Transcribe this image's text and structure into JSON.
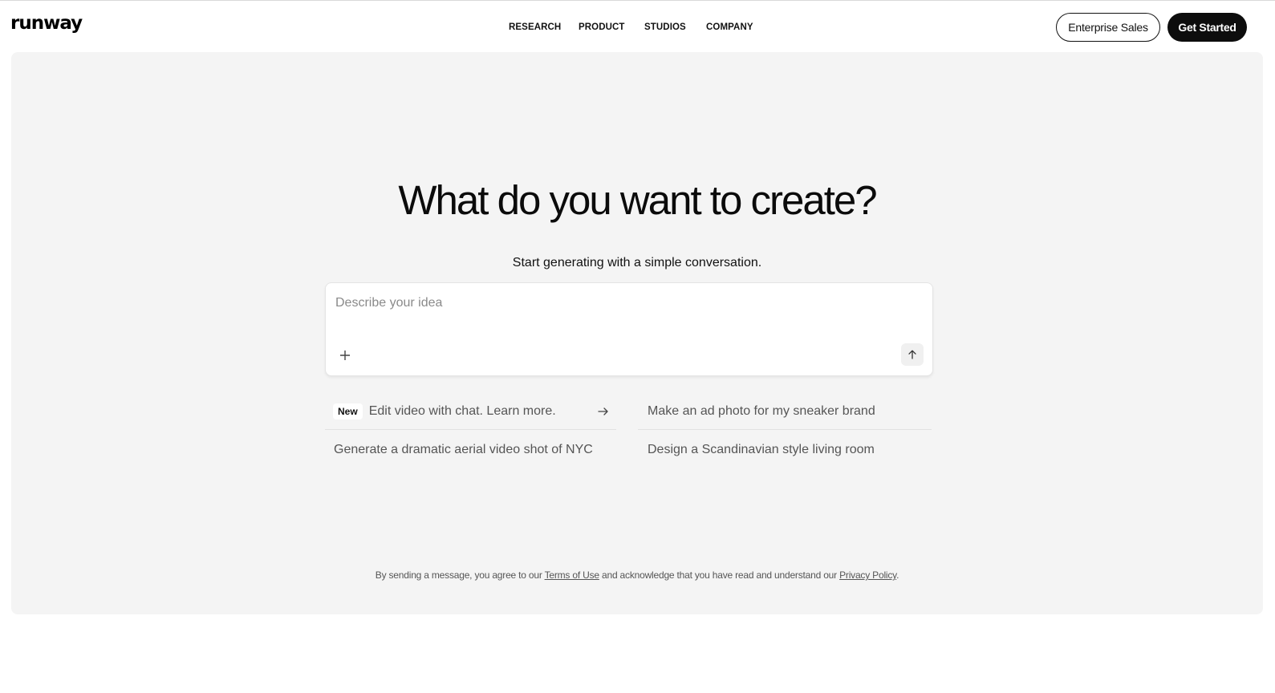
{
  "header": {
    "logo": "runway",
    "nav": [
      "RESEARCH",
      "PRODUCT",
      "STUDIOS",
      "COMPANY"
    ],
    "enterprise_label": "Enterprise Sales",
    "get_started_label": "Get Started"
  },
  "hero": {
    "title": "What do you want to create?",
    "subtitle": "Start generating with a simple conversation."
  },
  "prompt": {
    "placeholder": "Describe your idea",
    "value": "",
    "attach_icon": "plus-icon",
    "send_icon": "arrow-up-icon"
  },
  "suggestions": {
    "badge": "New",
    "items": [
      "Edit video with chat. Learn more.",
      "Make an ad photo for my sneaker brand",
      "Generate a dramatic aerial video shot of NYC",
      "Design a Scandinavian style living room"
    ],
    "arrow_icon": "arrow-right-icon"
  },
  "legal": {
    "prefix": "By sending a message, you agree to our ",
    "terms_label": "Terms of Use",
    "middle": " and acknowledge that you have read and understand our ",
    "privacy_label": "Privacy Policy",
    "suffix": "."
  }
}
